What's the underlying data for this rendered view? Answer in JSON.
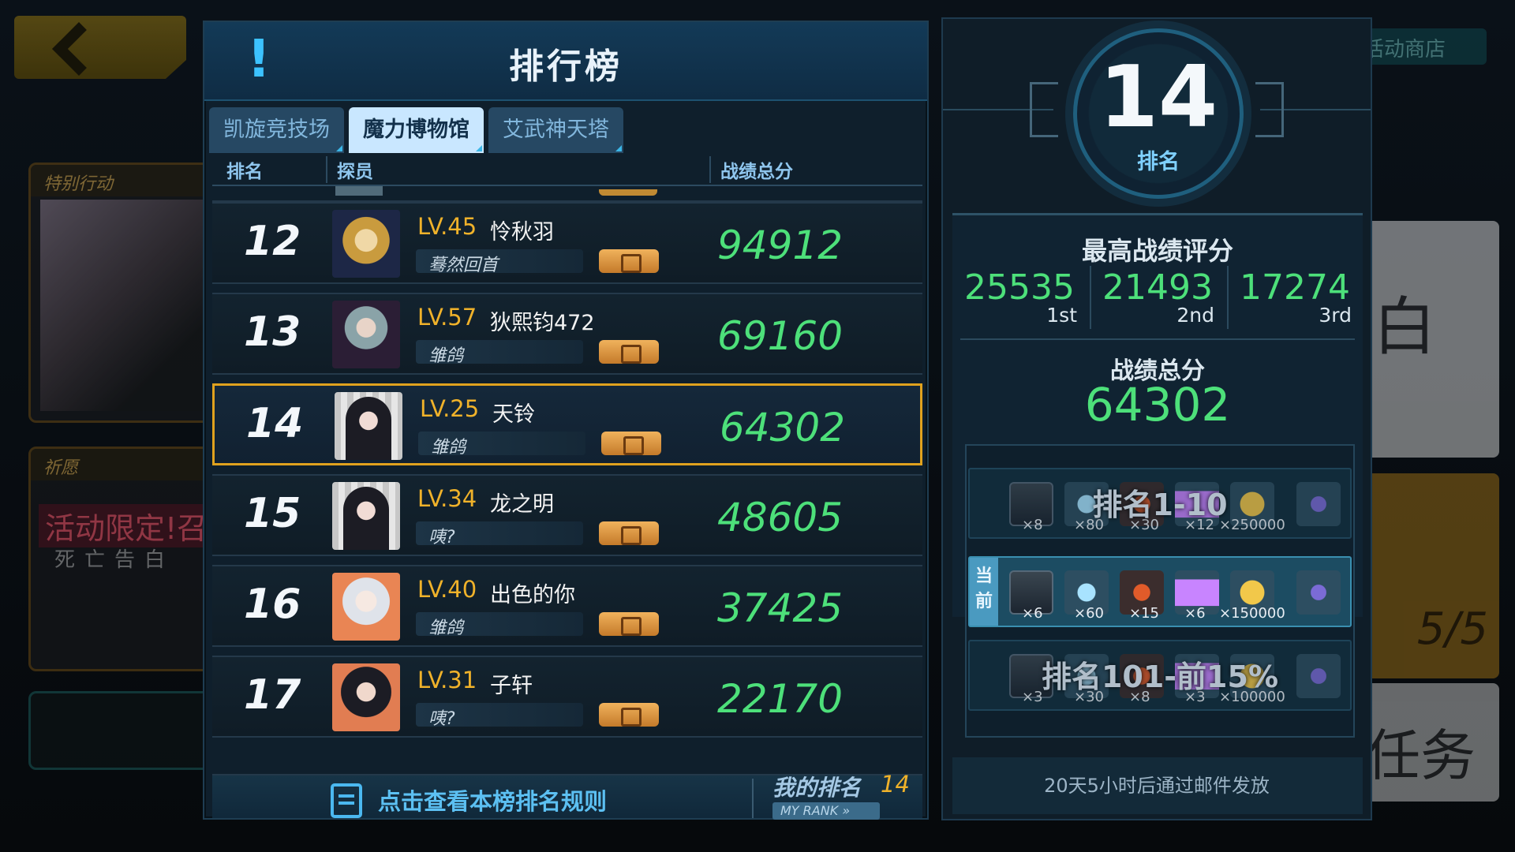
{
  "background": {
    "shop_label": "活动商店",
    "card1_header": "特别行动",
    "card2_header": "祈愿",
    "card2_line1": "活动限定!召唤",
    "card2_line2": "死亡告白",
    "right_card1_char": "白",
    "right_card2_text": "5/5",
    "right_card3_text": "任务"
  },
  "board": {
    "title": "排行榜",
    "tabs": [
      {
        "label": "凯旋竞技场",
        "active": false
      },
      {
        "label": "魔力博物馆",
        "active": true
      },
      {
        "label": "艾武神天塔",
        "active": false
      }
    ],
    "columns": {
      "rank": "排名",
      "agent": "探员",
      "score": "战绩总分"
    },
    "rows": [
      {
        "rank": "12",
        "level": "LV.45",
        "name": "怜秋羽",
        "title": "蓦然回首",
        "score": "94912",
        "avatar": "blonde"
      },
      {
        "rank": "13",
        "level": "LV.57",
        "name": "狄熙钧472",
        "title": "雏鸽",
        "score": "69160",
        "avatar": "glasses"
      },
      {
        "rank": "14",
        "level": "LV.25",
        "name": "天铃",
        "title": "雏鸽",
        "score": "64302",
        "avatar": "dark",
        "is_me": true
      },
      {
        "rank": "15",
        "level": "LV.34",
        "name": "龙之明",
        "title": "咦?",
        "score": "48605",
        "avatar": "dark"
      },
      {
        "rank": "16",
        "level": "LV.40",
        "name": "出色的你",
        "title": "雏鸽",
        "score": "37425",
        "avatar": "white"
      },
      {
        "rank": "17",
        "level": "LV.31",
        "name": "子轩",
        "title": "咦?",
        "score": "22170",
        "avatar": "dark2"
      }
    ],
    "rules_link": "点击查看本榜排名规则",
    "my_rank_label": "我的排名",
    "my_rank_value": "14",
    "my_rank_en": "MY RANK »"
  },
  "info": {
    "rank_value": "14",
    "rank_label": "排名",
    "best_title": "最高战绩评分",
    "best": [
      {
        "value": "25535",
        "ord": "1st"
      },
      {
        "value": "21493",
        "ord": "2nd"
      },
      {
        "value": "17274",
        "ord": "3rd"
      }
    ],
    "total_title": "战绩总分",
    "total_value": "64302",
    "reward_tiers": [
      {
        "label": "排名1-10",
        "quantities": [
          "×8",
          "×80",
          "×30",
          "×12",
          "×250000"
        ]
      },
      {
        "label": "",
        "current_tag": "当前",
        "quantities": [
          "×6",
          "×60",
          "×15",
          "×6",
          "×150000"
        ]
      },
      {
        "label": "排名101-前15%",
        "quantities": [
          "×3",
          "×30",
          "×8",
          "×3",
          "×100000"
        ]
      }
    ],
    "mail_note": "20天5小时后通过邮件发放"
  }
}
